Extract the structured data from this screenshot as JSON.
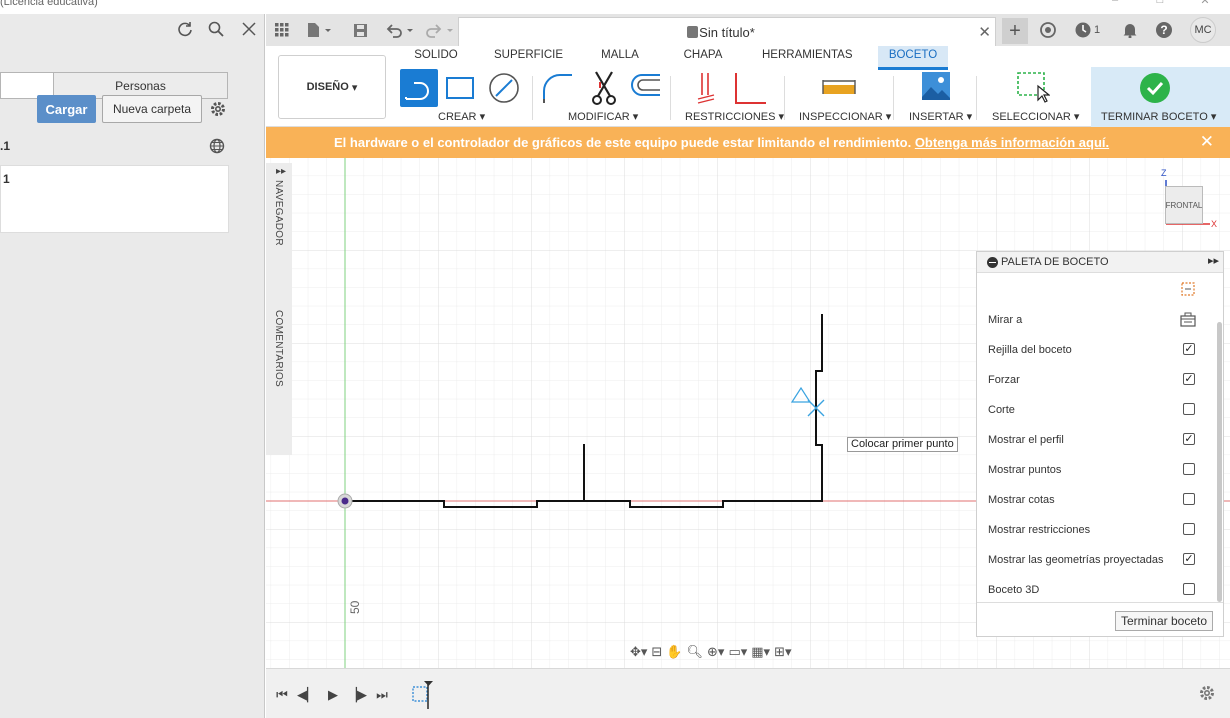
{
  "window": {
    "title": "(Licencia educativa)"
  },
  "left_panel": {
    "tab_people": "Personas",
    "upload_label": "Cargar",
    "new_folder_label": "Nueva carpeta",
    "project_label": ".1",
    "project_item": "1"
  },
  "document": {
    "title": "Sin título*",
    "notifications": "1",
    "avatar": "MC"
  },
  "toolbar": {
    "design_label": "DISEÑO",
    "tabs": [
      "SOLIDO",
      "SUPERFICIE",
      "MALLA",
      "CHAPA",
      "HERRAMIENTAS",
      "BOCETO"
    ],
    "active_tab": "BOCETO",
    "groups": [
      "CREAR",
      "MODIFICAR",
      "RESTRICCIONES",
      "INSPECCIONAR",
      "INSERTAR",
      "SELECCIONAR",
      "TERMINAR BOCETO"
    ]
  },
  "banner": {
    "message": "El hardware o el controlador de gráficos de este equipo puede estar limitando el rendimiento.",
    "link": "Obtenga más información aquí."
  },
  "side_nav": {
    "navigator": "NAVEGADOR",
    "comments": "COMENTARIOS"
  },
  "canvas": {
    "tooltip": "Colocar primer punto",
    "scale_label": "50",
    "viewcube_face": "FRONTAL",
    "axis_z": "Z",
    "axis_x": "X"
  },
  "palette": {
    "title": "PALETA DE BOCETO",
    "options": [
      {
        "label": "Mirar a",
        "type": "button"
      },
      {
        "label": "Rejilla del boceto",
        "checked": true
      },
      {
        "label": "Forzar",
        "checked": true
      },
      {
        "label": "Corte",
        "checked": false
      },
      {
        "label": "Mostrar el perfil",
        "checked": true
      },
      {
        "label": "Mostrar puntos",
        "checked": false
      },
      {
        "label": "Mostrar cotas",
        "checked": false
      },
      {
        "label": "Mostrar restricciones",
        "checked": false
      },
      {
        "label": "Mostrar las geometrías proyectadas",
        "checked": true
      },
      {
        "label": "Boceto 3D",
        "checked": false
      }
    ],
    "finish_button": "Terminar boceto"
  },
  "colors": {
    "accent": "#1a7cd3",
    "banner": "#f9b257",
    "upload_button": "#5b8fc9",
    "finish_check": "#2db34a"
  }
}
